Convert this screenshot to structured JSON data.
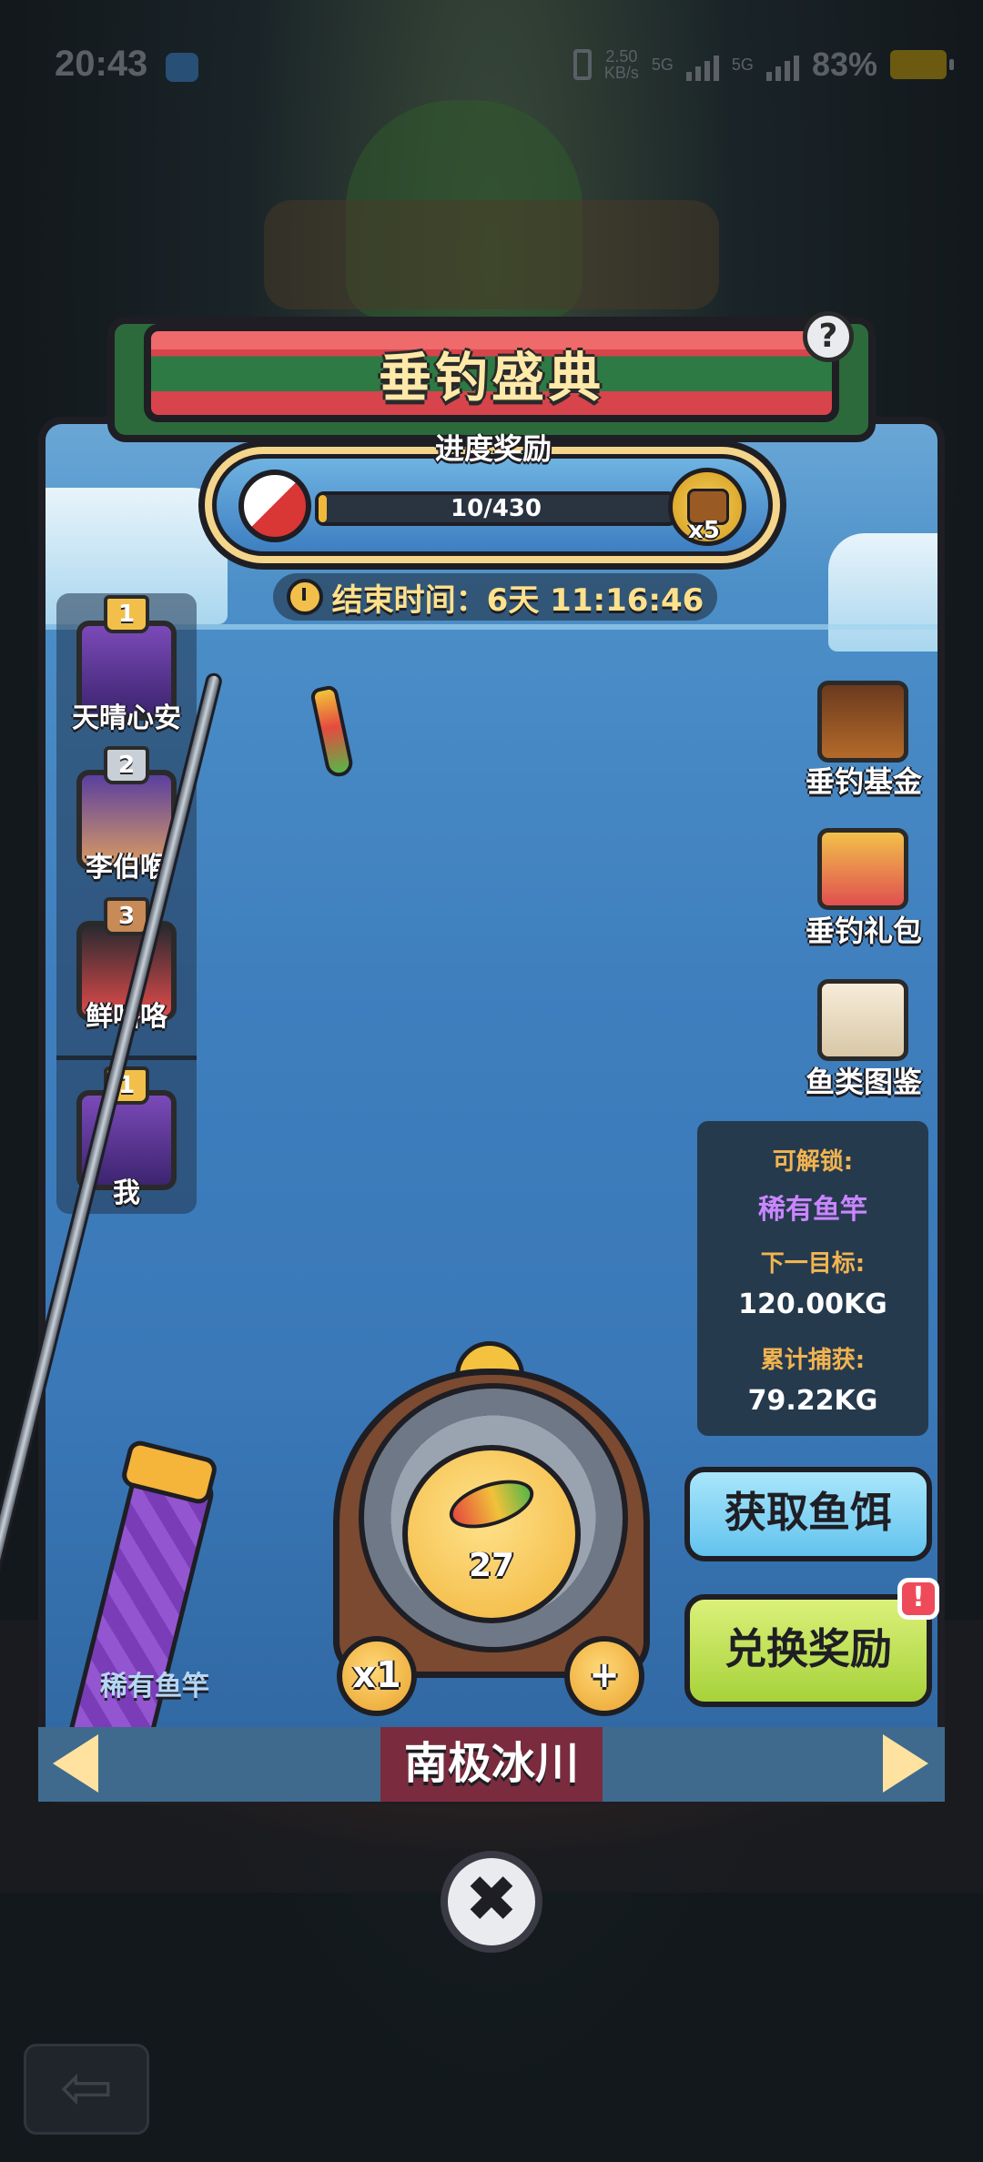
{
  "status_bar": {
    "time": "20:43",
    "network_speed": "2.50",
    "network_unit": "KB/s",
    "signal_1": "5G",
    "signal_2": "5G",
    "battery_percent": "83%"
  },
  "event": {
    "title": "垂钓盛典",
    "help_icon": "question-icon",
    "help_label": "?"
  },
  "progress": {
    "title": "进度奖励",
    "current": 10,
    "total": 430,
    "text": "10/430",
    "fraction": 0.023,
    "reward_multiplier": "x5"
  },
  "timer": {
    "label": "结束时间：6天 11:16:46"
  },
  "leaderboard": {
    "entries": [
      {
        "rank": "1",
        "name": "天晴心安"
      },
      {
        "rank": "2",
        "name": "李伯喉"
      },
      {
        "rank": "3",
        "name": "鲜咯咯"
      }
    ],
    "me": {
      "rank": "1",
      "name": "我"
    }
  },
  "side_menu": [
    {
      "label": "垂钓基金",
      "icon": "fund-chart-icon"
    },
    {
      "label": "垂钓礼包",
      "icon": "gift-box-icon"
    },
    {
      "label": "鱼类图鉴",
      "icon": "fish-book-icon"
    }
  ],
  "unlock_panel": {
    "unlockable_label": "可解锁:",
    "unlockable_value": "稀有鱼竿",
    "next_target_label": "下一目标:",
    "next_target_value": "120.00KG",
    "total_catch_label": "累计捕获:",
    "total_catch_value": "79.22KG"
  },
  "rod": {
    "name": "稀有鱼竿"
  },
  "reel": {
    "bait_count": "27",
    "multiplier": "x1",
    "add_label": "+"
  },
  "actions": {
    "get_bait": "获取鱼饵",
    "redeem": "兑换奖励",
    "alert_badge": "!"
  },
  "location": {
    "name": "南极冰川"
  },
  "controls": {
    "close_label": "✖",
    "back_label": "⇦"
  },
  "colors": {
    "banner_green": "#2d7a44",
    "banner_red": "#d8444c",
    "title_text": "#ffe9a8",
    "progress_fill": "#f1b93a",
    "action_blue": "#63c3ee",
    "action_green": "#a6d23a",
    "alert": "#ef4a5a",
    "unlock_accent": "#c986ff"
  }
}
